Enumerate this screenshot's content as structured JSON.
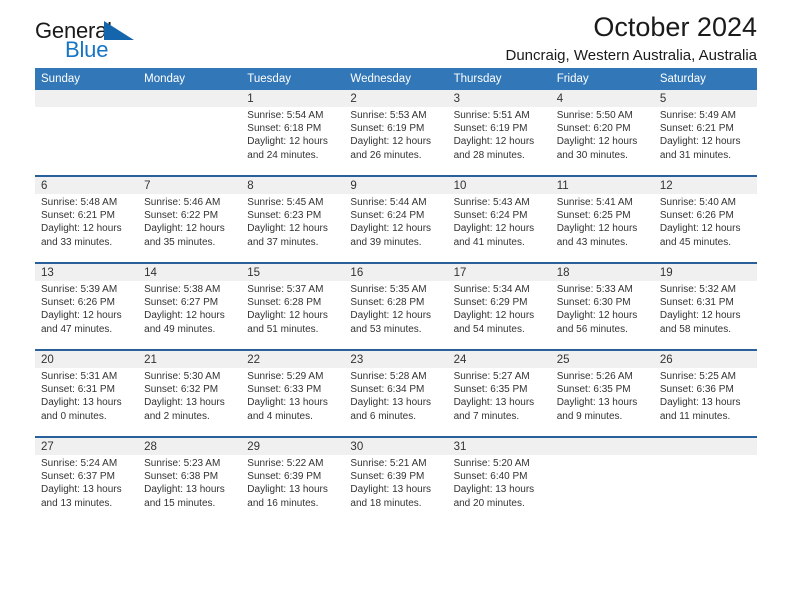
{
  "brand": {
    "name_part1": "General",
    "name_part2": "Blue",
    "triangle_color": "#1565ad",
    "blue_color": "#1775c4"
  },
  "header": {
    "month_title": "October 2024",
    "location": "Duncraig, Western Australia, Australia"
  },
  "theme": {
    "header_blue": "#3277b8",
    "separator_blue": "#2a6099",
    "daynum_band": "#f0f0f0"
  },
  "weekdays": [
    "Sunday",
    "Monday",
    "Tuesday",
    "Wednesday",
    "Thursday",
    "Friday",
    "Saturday"
  ],
  "weeks": [
    {
      "days": [
        {
          "num": "",
          "sunrise": "",
          "sunset": "",
          "daylight1": "",
          "daylight2": ""
        },
        {
          "num": "",
          "sunrise": "",
          "sunset": "",
          "daylight1": "",
          "daylight2": ""
        },
        {
          "num": "1",
          "sunrise": "Sunrise: 5:54 AM",
          "sunset": "Sunset: 6:18 PM",
          "daylight1": "Daylight: 12 hours",
          "daylight2": "and 24 minutes."
        },
        {
          "num": "2",
          "sunrise": "Sunrise: 5:53 AM",
          "sunset": "Sunset: 6:19 PM",
          "daylight1": "Daylight: 12 hours",
          "daylight2": "and 26 minutes."
        },
        {
          "num": "3",
          "sunrise": "Sunrise: 5:51 AM",
          "sunset": "Sunset: 6:19 PM",
          "daylight1": "Daylight: 12 hours",
          "daylight2": "and 28 minutes."
        },
        {
          "num": "4",
          "sunrise": "Sunrise: 5:50 AM",
          "sunset": "Sunset: 6:20 PM",
          "daylight1": "Daylight: 12 hours",
          "daylight2": "and 30 minutes."
        },
        {
          "num": "5",
          "sunrise": "Sunrise: 5:49 AM",
          "sunset": "Sunset: 6:21 PM",
          "daylight1": "Daylight: 12 hours",
          "daylight2": "and 31 minutes."
        }
      ]
    },
    {
      "days": [
        {
          "num": "6",
          "sunrise": "Sunrise: 5:48 AM",
          "sunset": "Sunset: 6:21 PM",
          "daylight1": "Daylight: 12 hours",
          "daylight2": "and 33 minutes."
        },
        {
          "num": "7",
          "sunrise": "Sunrise: 5:46 AM",
          "sunset": "Sunset: 6:22 PM",
          "daylight1": "Daylight: 12 hours",
          "daylight2": "and 35 minutes."
        },
        {
          "num": "8",
          "sunrise": "Sunrise: 5:45 AM",
          "sunset": "Sunset: 6:23 PM",
          "daylight1": "Daylight: 12 hours",
          "daylight2": "and 37 minutes."
        },
        {
          "num": "9",
          "sunrise": "Sunrise: 5:44 AM",
          "sunset": "Sunset: 6:24 PM",
          "daylight1": "Daylight: 12 hours",
          "daylight2": "and 39 minutes."
        },
        {
          "num": "10",
          "sunrise": "Sunrise: 5:43 AM",
          "sunset": "Sunset: 6:24 PM",
          "daylight1": "Daylight: 12 hours",
          "daylight2": "and 41 minutes."
        },
        {
          "num": "11",
          "sunrise": "Sunrise: 5:41 AM",
          "sunset": "Sunset: 6:25 PM",
          "daylight1": "Daylight: 12 hours",
          "daylight2": "and 43 minutes."
        },
        {
          "num": "12",
          "sunrise": "Sunrise: 5:40 AM",
          "sunset": "Sunset: 6:26 PM",
          "daylight1": "Daylight: 12 hours",
          "daylight2": "and 45 minutes."
        }
      ]
    },
    {
      "days": [
        {
          "num": "13",
          "sunrise": "Sunrise: 5:39 AM",
          "sunset": "Sunset: 6:26 PM",
          "daylight1": "Daylight: 12 hours",
          "daylight2": "and 47 minutes."
        },
        {
          "num": "14",
          "sunrise": "Sunrise: 5:38 AM",
          "sunset": "Sunset: 6:27 PM",
          "daylight1": "Daylight: 12 hours",
          "daylight2": "and 49 minutes."
        },
        {
          "num": "15",
          "sunrise": "Sunrise: 5:37 AM",
          "sunset": "Sunset: 6:28 PM",
          "daylight1": "Daylight: 12 hours",
          "daylight2": "and 51 minutes."
        },
        {
          "num": "16",
          "sunrise": "Sunrise: 5:35 AM",
          "sunset": "Sunset: 6:28 PM",
          "daylight1": "Daylight: 12 hours",
          "daylight2": "and 53 minutes."
        },
        {
          "num": "17",
          "sunrise": "Sunrise: 5:34 AM",
          "sunset": "Sunset: 6:29 PM",
          "daylight1": "Daylight: 12 hours",
          "daylight2": "and 54 minutes."
        },
        {
          "num": "18",
          "sunrise": "Sunrise: 5:33 AM",
          "sunset": "Sunset: 6:30 PM",
          "daylight1": "Daylight: 12 hours",
          "daylight2": "and 56 minutes."
        },
        {
          "num": "19",
          "sunrise": "Sunrise: 5:32 AM",
          "sunset": "Sunset: 6:31 PM",
          "daylight1": "Daylight: 12 hours",
          "daylight2": "and 58 minutes."
        }
      ]
    },
    {
      "days": [
        {
          "num": "20",
          "sunrise": "Sunrise: 5:31 AM",
          "sunset": "Sunset: 6:31 PM",
          "daylight1": "Daylight: 13 hours",
          "daylight2": "and 0 minutes."
        },
        {
          "num": "21",
          "sunrise": "Sunrise: 5:30 AM",
          "sunset": "Sunset: 6:32 PM",
          "daylight1": "Daylight: 13 hours",
          "daylight2": "and 2 minutes."
        },
        {
          "num": "22",
          "sunrise": "Sunrise: 5:29 AM",
          "sunset": "Sunset: 6:33 PM",
          "daylight1": "Daylight: 13 hours",
          "daylight2": "and 4 minutes."
        },
        {
          "num": "23",
          "sunrise": "Sunrise: 5:28 AM",
          "sunset": "Sunset: 6:34 PM",
          "daylight1": "Daylight: 13 hours",
          "daylight2": "and 6 minutes."
        },
        {
          "num": "24",
          "sunrise": "Sunrise: 5:27 AM",
          "sunset": "Sunset: 6:35 PM",
          "daylight1": "Daylight: 13 hours",
          "daylight2": "and 7 minutes."
        },
        {
          "num": "25",
          "sunrise": "Sunrise: 5:26 AM",
          "sunset": "Sunset: 6:35 PM",
          "daylight1": "Daylight: 13 hours",
          "daylight2": "and 9 minutes."
        },
        {
          "num": "26",
          "sunrise": "Sunrise: 5:25 AM",
          "sunset": "Sunset: 6:36 PM",
          "daylight1": "Daylight: 13 hours",
          "daylight2": "and 11 minutes."
        }
      ]
    },
    {
      "days": [
        {
          "num": "27",
          "sunrise": "Sunrise: 5:24 AM",
          "sunset": "Sunset: 6:37 PM",
          "daylight1": "Daylight: 13 hours",
          "daylight2": "and 13 minutes."
        },
        {
          "num": "28",
          "sunrise": "Sunrise: 5:23 AM",
          "sunset": "Sunset: 6:38 PM",
          "daylight1": "Daylight: 13 hours",
          "daylight2": "and 15 minutes."
        },
        {
          "num": "29",
          "sunrise": "Sunrise: 5:22 AM",
          "sunset": "Sunset: 6:39 PM",
          "daylight1": "Daylight: 13 hours",
          "daylight2": "and 16 minutes."
        },
        {
          "num": "30",
          "sunrise": "Sunrise: 5:21 AM",
          "sunset": "Sunset: 6:39 PM",
          "daylight1": "Daylight: 13 hours",
          "daylight2": "and 18 minutes."
        },
        {
          "num": "31",
          "sunrise": "Sunrise: 5:20 AM",
          "sunset": "Sunset: 6:40 PM",
          "daylight1": "Daylight: 13 hours",
          "daylight2": "and 20 minutes."
        },
        {
          "num": "",
          "sunrise": "",
          "sunset": "",
          "daylight1": "",
          "daylight2": ""
        },
        {
          "num": "",
          "sunrise": "",
          "sunset": "",
          "daylight1": "",
          "daylight2": ""
        }
      ]
    }
  ]
}
